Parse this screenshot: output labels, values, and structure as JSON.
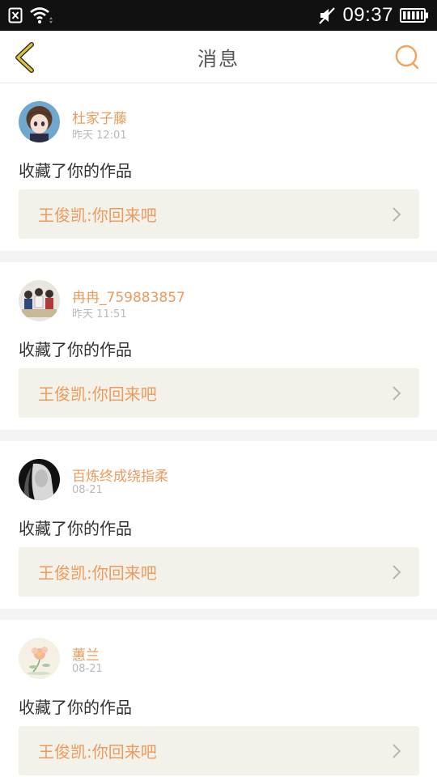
{
  "status_bar": {
    "time": "09:37",
    "icons": [
      "close-box-icon",
      "wifi-icon",
      "mute-icon",
      "battery-icon"
    ]
  },
  "header": {
    "title": "消息",
    "back_icon": "chevron-left-icon",
    "search_icon": "search-icon",
    "accent_color": "#f0a45c",
    "back_color": "#e3c23a"
  },
  "messages": [
    {
      "user": "杜家子藤",
      "time": "昨天  12:01",
      "action": "收藏了你的作品",
      "work": "王俊凯:你回来吧",
      "avatar": "avatar-anime-girl"
    },
    {
      "user": "冉冉_759883857",
      "time": "昨天  11:51",
      "action": "收藏了你的作品",
      "work": "王俊凯:你回来吧",
      "avatar": "avatar-group-photo"
    },
    {
      "user": "百炼终成绕指柔",
      "time": "08-21",
      "action": "收藏了你的作品",
      "work": "王俊凯:你回来吧",
      "avatar": "avatar-bw-portrait"
    },
    {
      "user": "蕙兰",
      "time": "08-21",
      "action": "收藏了你的作品",
      "work": "王俊凯:你回来吧",
      "avatar": "avatar-flower"
    }
  ],
  "colors": {
    "username": "#ee9a5b",
    "card_link_bg": "#f3f2ea"
  }
}
